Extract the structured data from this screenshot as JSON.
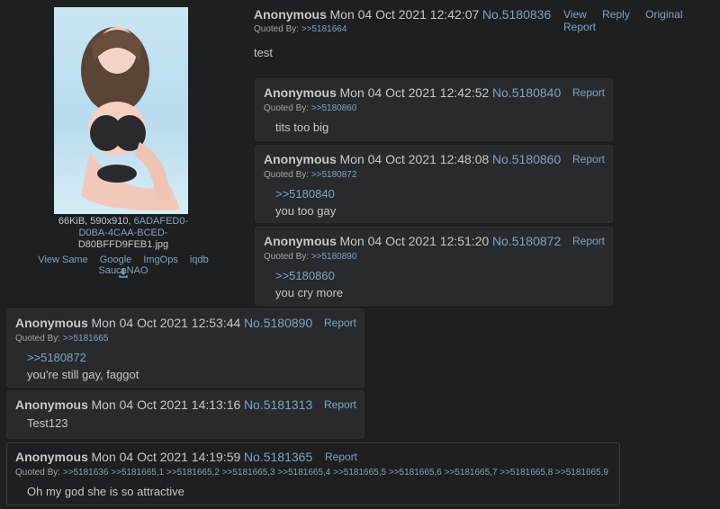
{
  "op": {
    "name": "Anonymous",
    "date": "Mon 04 Oct 2021 12:42:07",
    "no": "No.5180836",
    "quoted_by_label": "Quoted By:",
    "quoted_by": ">>5181664",
    "actions": [
      "View",
      "Reply",
      "Original",
      "Report"
    ],
    "body": "test",
    "file": {
      "size_dims": "66KiB, 590x910,",
      "name_line1": "6ADAFED0-",
      "name_line2": "D0BA-4CAA-BCED-",
      "name_line3": "D80BFFD9FEB1.jpg",
      "links": [
        "View Same",
        "Google",
        "ImgOps",
        "iqdb",
        "SauceNAO"
      ]
    }
  },
  "replies": [
    {
      "name": "Anonymous",
      "date": "Mon 04 Oct 2021 12:42:52",
      "no": "No.5180840",
      "report": "Report",
      "quoted_by_label": "Quoted By:",
      "quoted_by": ">>5180860",
      "quote": "",
      "text": "tits too big"
    },
    {
      "name": "Anonymous",
      "date": "Mon 04 Oct 2021 12:48:08",
      "no": "No.5180860",
      "report": "Report",
      "quoted_by_label": "Quoted By:",
      "quoted_by": ">>5180872",
      "quote": ">>5180840",
      "text": "you too gay"
    },
    {
      "name": "Anonymous",
      "date": "Mon 04 Oct 2021 12:51:20",
      "no": "No.5180872",
      "report": "Report",
      "quoted_by_label": "Quoted By:",
      "quoted_by": ">>5180890",
      "quote": ">>5180860",
      "text": "you cry more"
    },
    {
      "name": "Anonymous",
      "date": "Mon 04 Oct 2021 12:53:44",
      "no": "No.5180890",
      "report": "Report",
      "quoted_by_label": "Quoted By:",
      "quoted_by": ">>5181665",
      "quote": ">>5180872",
      "text": "you're still gay, faggot"
    },
    {
      "name": "Anonymous",
      "date": "Mon 04 Oct 2021 14:13:16",
      "no": "No.5181313",
      "report": "Report",
      "text": "Test123"
    },
    {
      "name": "Anonymous",
      "date": "Mon 04 Oct 2021 14:19:59",
      "no": "No.5181365",
      "report": "Report",
      "quoted_by_label": "Quoted By:",
      "quoted_by": ">>5181636 >>5181665,1 >>5181665,2 >>5181665,3 >>5181665,4 >>5181665,5 >>5181665,6 >>5181665,7 >>5181665,8 >>5181665,9",
      "text": "Oh my god she is so attractive"
    }
  ],
  "icons": {
    "download": "download-icon"
  }
}
